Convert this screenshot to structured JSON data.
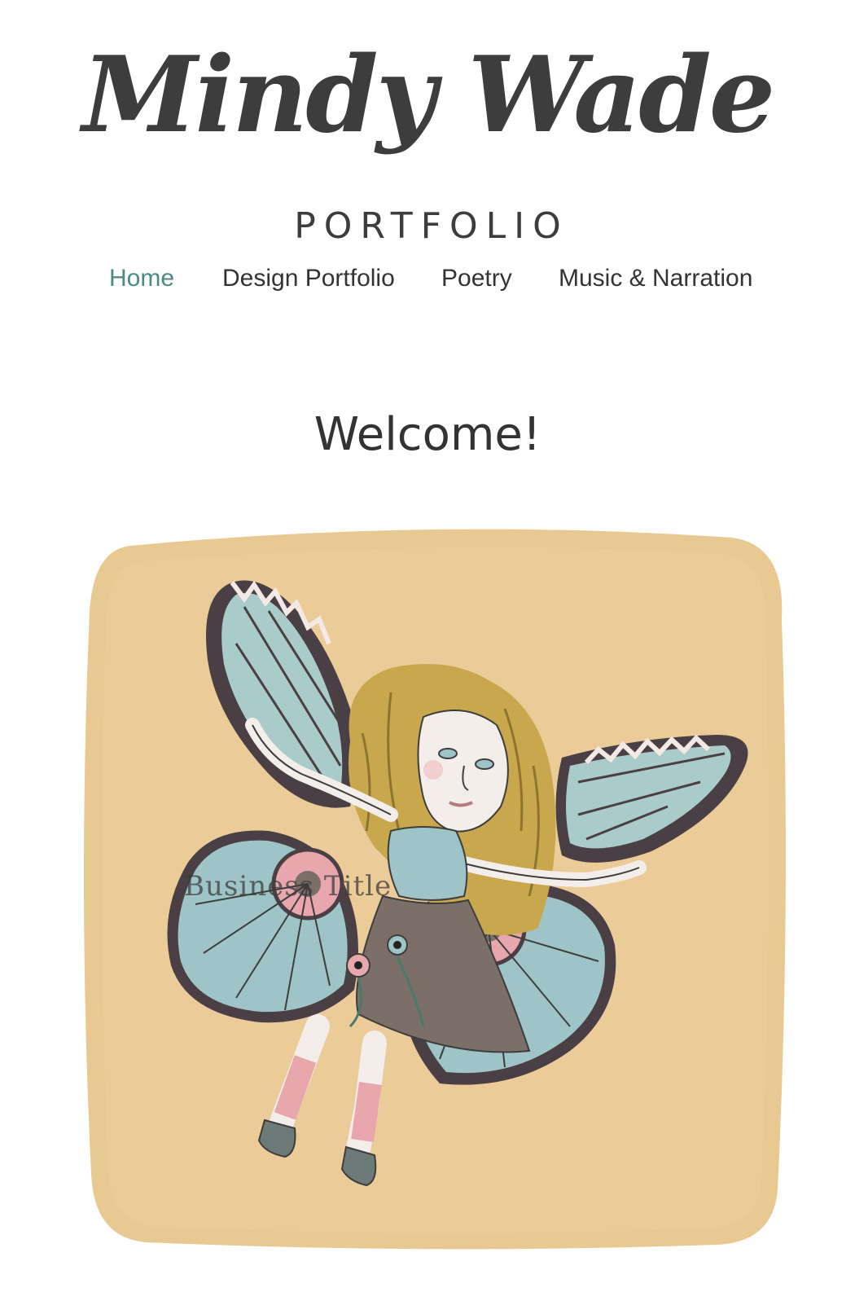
{
  "header": {
    "title": "Mindy Wade",
    "subtitle": "PORTFOLIO"
  },
  "nav": {
    "items": [
      {
        "label": "Home",
        "active": true
      },
      {
        "label": "Design Portfolio",
        "active": false
      },
      {
        "label": "Poetry",
        "active": false
      },
      {
        "label": "Music & Narration",
        "active": false
      }
    ],
    "active_color": "#4e8a84",
    "text_color": "#333333"
  },
  "main": {
    "heading": "Welcome!",
    "hero_image": {
      "subject": "illustration of a winged fairy girl doll",
      "watermark": "Business Title"
    }
  },
  "colors": {
    "background": "#ffffff",
    "hero_backdrop": "#e9c992",
    "wing_blue": "#9fc4c8",
    "wing_dark": "#4a3f44",
    "accent_pink": "#e8a7ad",
    "hair": "#c9a84d",
    "dress": "#7b6f68"
  }
}
